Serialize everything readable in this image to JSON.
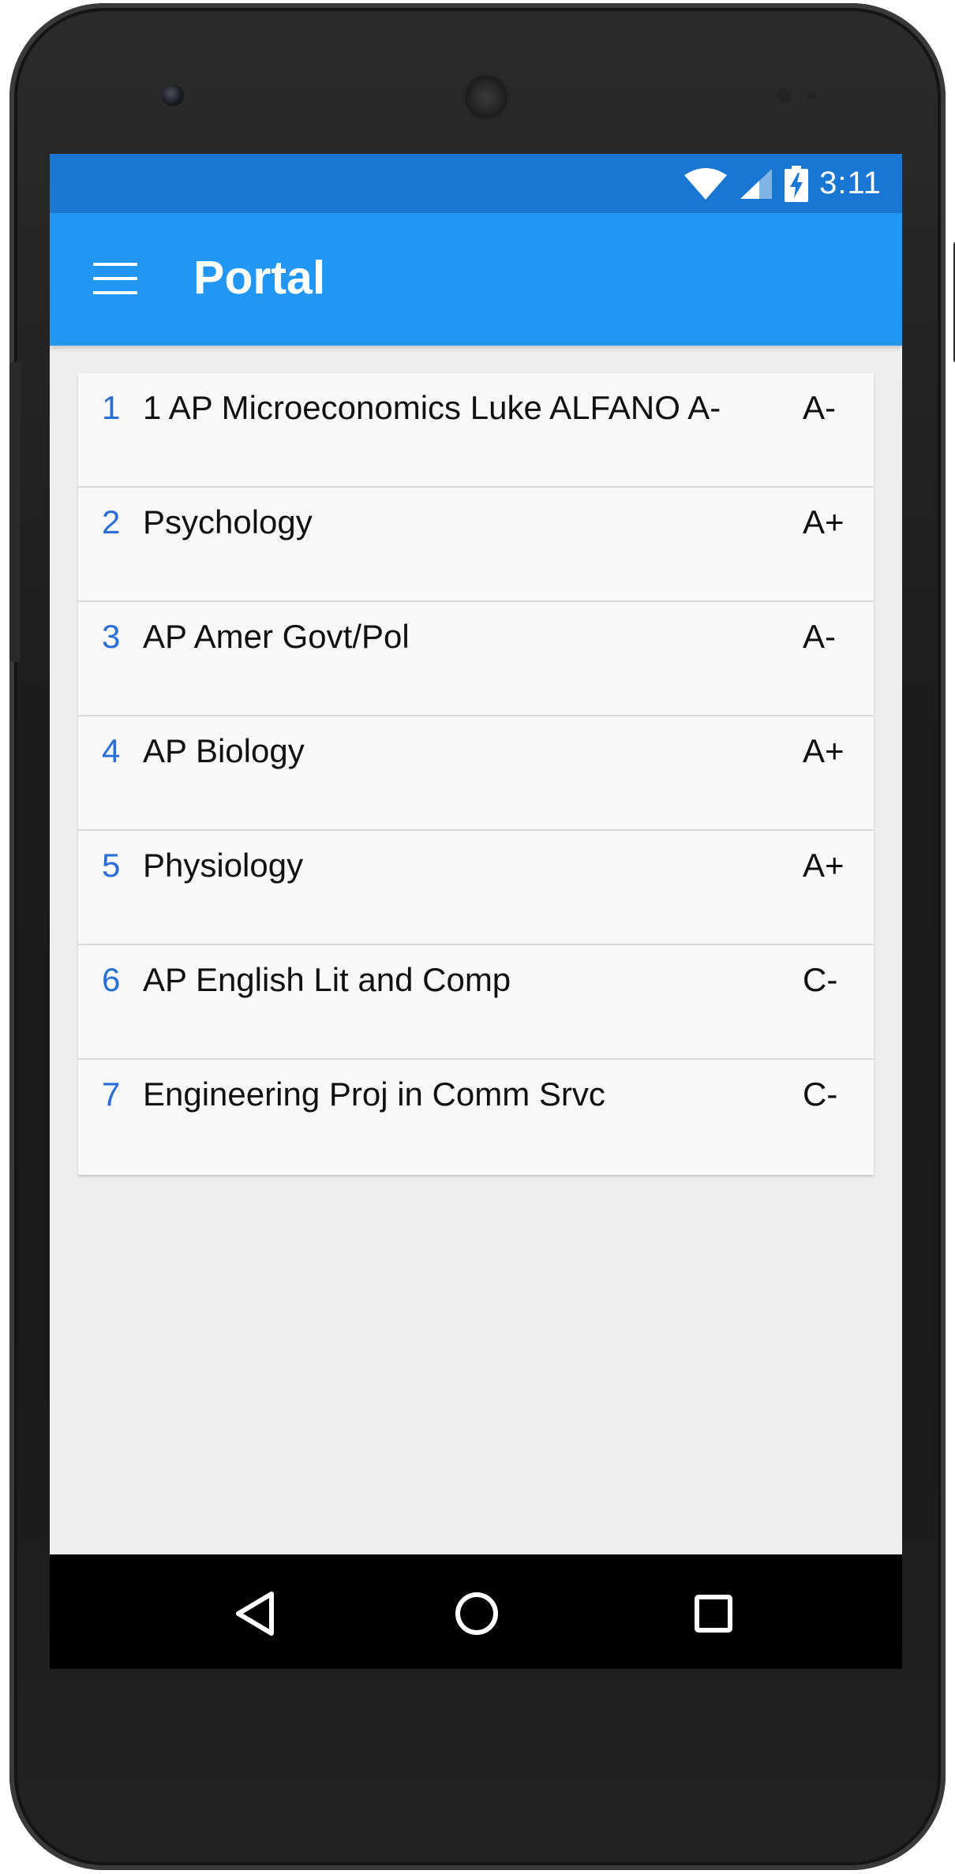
{
  "status_bar": {
    "time": "3:11"
  },
  "app_bar": {
    "title": "Portal",
    "menu_icon": "hamburger-menu-icon"
  },
  "courses": [
    {
      "number": "1",
      "name": "1 AP Microeconomics Luke ALFANO A-",
      "grade": "A-"
    },
    {
      "number": "2",
      "name": "Psychology",
      "grade": "A+"
    },
    {
      "number": "3",
      "name": "AP Amer Govt/Pol",
      "grade": "A-"
    },
    {
      "number": "4",
      "name": "AP Biology",
      "grade": "A+"
    },
    {
      "number": "5",
      "name": "Physiology",
      "grade": "A+"
    },
    {
      "number": "6",
      "name": "AP English Lit and Comp",
      "grade": "C-"
    },
    {
      "number": "7",
      "name": "Engineering Proj in Comm Srvc",
      "grade": "C-"
    }
  ],
  "nav_bar": {
    "back_icon": "back-triangle-icon",
    "home_icon": "home-circle-icon",
    "recent_icon": "recent-apps-square-icon"
  },
  "colors": {
    "status_bar": "#1976d2",
    "app_bar": "#2196f3",
    "number_accent": "#2a6ed8",
    "list_bg": "#f8f8f8",
    "screen_bg": "#eeeeee"
  }
}
